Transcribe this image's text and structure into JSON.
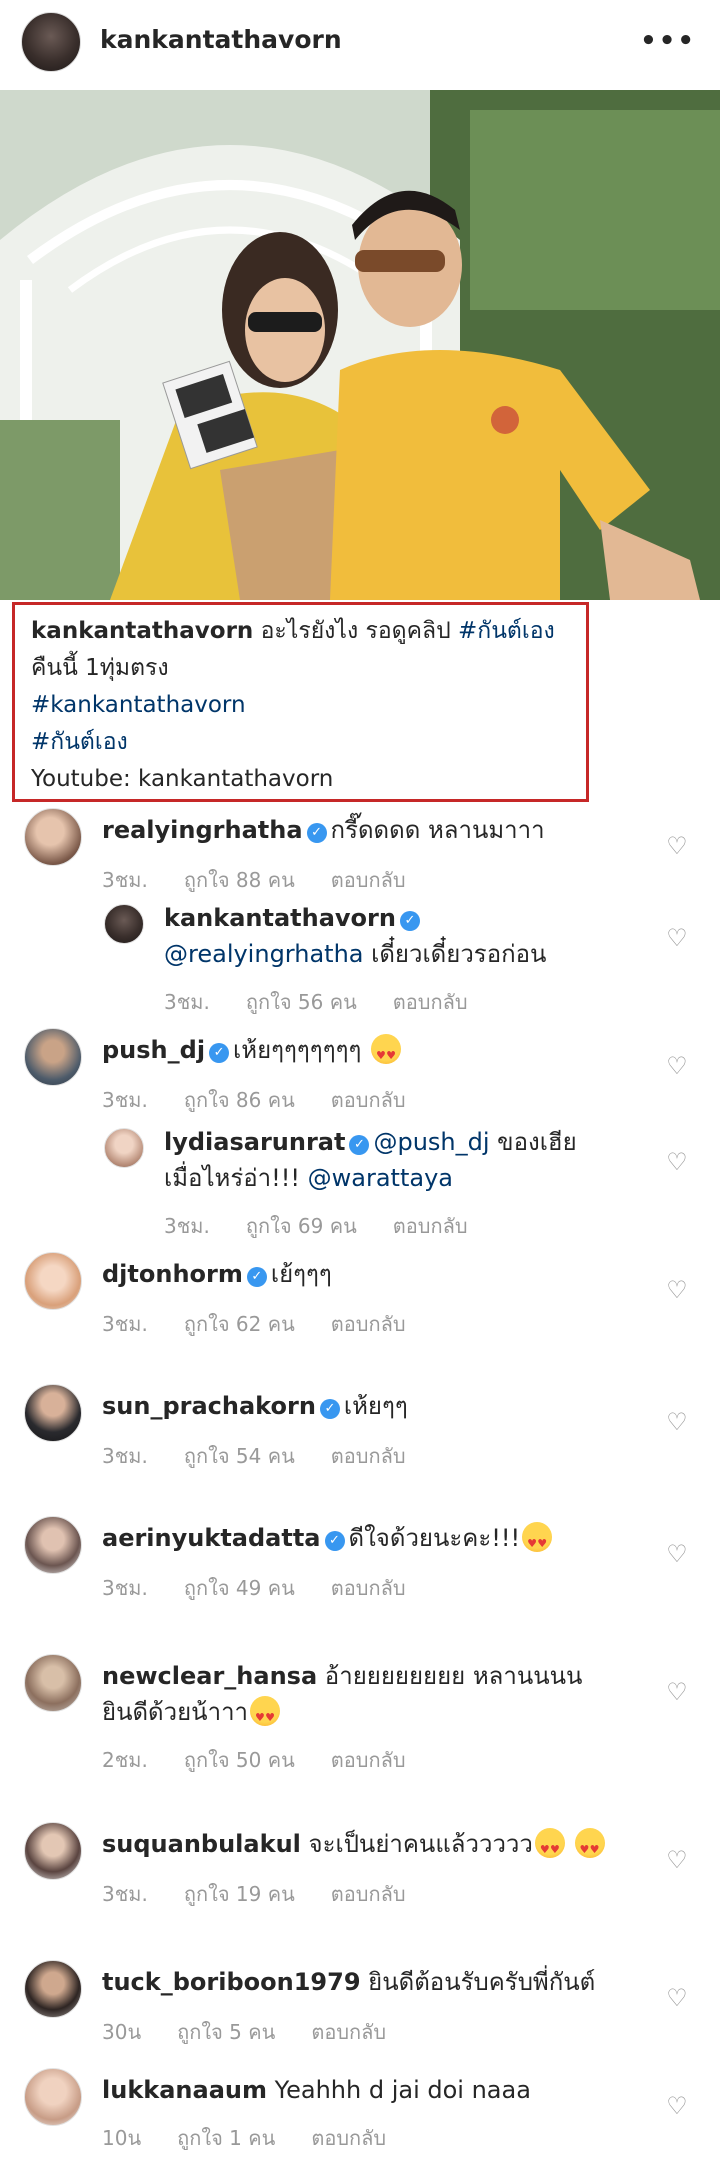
{
  "header": {
    "username": "kankantathavorn",
    "more_label": "•••"
  },
  "caption": {
    "username": "kankantathavorn",
    "line1_text": "อะไรยังไง รอดูคลิป",
    "line1_tag": "#กันต์เอง",
    "line2": "คืนนี้ 1ทุ่มตรง",
    "line3_tag": "#kankantathavorn",
    "line4_tag": "#กันต์เอง",
    "line5": "Youtube: kankantathavorn"
  },
  "comments": [
    {
      "user": "realyingrhatha",
      "verified": true,
      "text": "กรี๊ดดดด หลานมาาา",
      "time": "3ชม.",
      "likes": "ถูกใจ 88 คน",
      "reply": "ตอบกลับ"
    },
    {
      "user": "kankantathavorn",
      "verified": true,
      "mention": "@realyingrhatha",
      "text": "เดี๋ยวเดี๋ยวรอก่อน",
      "time": "3ชม.",
      "likes": "ถูกใจ 56 คน",
      "reply": "ตอบกลับ"
    },
    {
      "user": "push_dj",
      "verified": true,
      "text": "เห้ยๆๆๆๆๆๆๆ",
      "time": "3ชม.",
      "likes": "ถูกใจ 86 คน",
      "reply": "ตอบกลับ"
    },
    {
      "user": "lydiasarunrat",
      "verified": true,
      "mention": "@push_dj",
      "text": "ของเฮีย",
      "text2": "เมื่อไหร่อ่า!!!",
      "mention2": "@warattaya",
      "time": "3ชม.",
      "likes": "ถูกใจ 69 คน",
      "reply": "ตอบกลับ"
    },
    {
      "user": "djtonhorm",
      "verified": true,
      "text": "เย้ๆๆๆ",
      "time": "3ชม.",
      "likes": "ถูกใจ 62 คน",
      "reply": "ตอบกลับ"
    },
    {
      "user": "sun_prachakorn",
      "verified": true,
      "text": "เห้ยๆๆ",
      "time": "3ชม.",
      "likes": "ถูกใจ 54 คน",
      "reply": "ตอบกลับ"
    },
    {
      "user": "aerinyuktadatta",
      "verified": true,
      "text": "ดีใจด้วยนะคะ!!!",
      "time": "3ชม.",
      "likes": "ถูกใจ 49 คน",
      "reply": "ตอบกลับ"
    },
    {
      "user": "newclear_hansa",
      "verified": false,
      "text": "อ้ายยยยยยยย หลานนนน",
      "text2": "ยินดีด้วยน้าาา",
      "time": "2ชม.",
      "likes": "ถูกใจ 50 คน",
      "reply": "ตอบกลับ"
    },
    {
      "user": "suquanbulakul",
      "verified": false,
      "text": "จะเป็นย่าคนแล้ววววว",
      "time": "3ชม.",
      "likes": "ถูกใจ 19 คน",
      "reply": "ตอบกลับ"
    },
    {
      "user": "tuck_boriboon1979",
      "verified": false,
      "text": "ยินดีต้อนรับครับพี่กันต์",
      "time": "30น",
      "likes": "ถูกใจ 5 คน",
      "reply": "ตอบกลับ"
    },
    {
      "user": "lukkanaaum",
      "verified": false,
      "text": "Yeahhh d jai doi naaa",
      "time": "10น",
      "likes": "ถูกใจ 1 คน",
      "reply": "ตอบกลับ"
    }
  ],
  "icons": {
    "heart": "heart-outline-icon",
    "verified": "verified-badge-icon",
    "emoji": "heart-eyes-emoji-icon"
  },
  "colors": {
    "accent_link": "#003569",
    "verified_blue": "#3897f0",
    "highlight_border": "#c62828",
    "meta_gray": "#999999"
  }
}
